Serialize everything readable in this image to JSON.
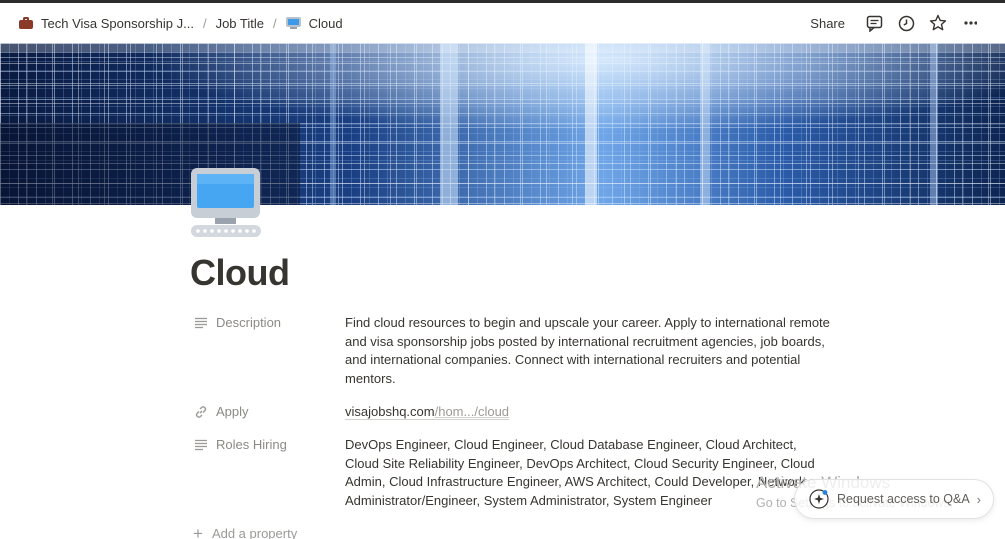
{
  "breadcrumb": {
    "items": [
      {
        "label": "Tech Visa Sponsorship J...",
        "icon": "briefcase-icon"
      },
      {
        "label": "Job Title",
        "icon": ""
      },
      {
        "label": "Cloud",
        "icon": "desktop-computer-icon"
      }
    ]
  },
  "topbar": {
    "share_label": "Share",
    "icons": [
      "comment-icon",
      "clock-icon",
      "star-icon",
      "more-icon"
    ]
  },
  "page": {
    "icon": "desktop-computer-icon",
    "title": "Cloud"
  },
  "properties": [
    {
      "name": "Description",
      "icon": "text-lines-icon",
      "value": "Find cloud resources to begin and upscale your career. Apply to international remote and visa sponsorship jobs posted by international recruitment agencies, job boards, and international companies. Connect with international recruiters and potential mentors."
    },
    {
      "name": "Apply",
      "icon": "link-icon",
      "value_domain": "visajobshq.com",
      "value_path": "/hom.../cloud"
    },
    {
      "name": "Roles Hiring",
      "icon": "text-lines-icon",
      "value": "DevOps Engineer, Cloud Engineer, Cloud Database Engineer, Cloud Architect, Cloud Site Reliability Engineer, DevOps Architect, Cloud Security Engineer, Cloud Admin, Cloud Infrastructure Engineer, AWS Architect, Could Developer, Network Administrator/Engineer, System Administrator, System Engineer"
    }
  ],
  "add_property_label": "Add a property",
  "watermark": {
    "line1": "Activate Windows",
    "line2": "Go to Settings to activate Windows."
  },
  "qa_button": {
    "label": "Request access to Q&A"
  },
  "colors": {
    "text": "#37352f",
    "muted": "#8b8a86",
    "cover_dark": "#0b1a3a",
    "cover_light": "#9fc8ff"
  }
}
